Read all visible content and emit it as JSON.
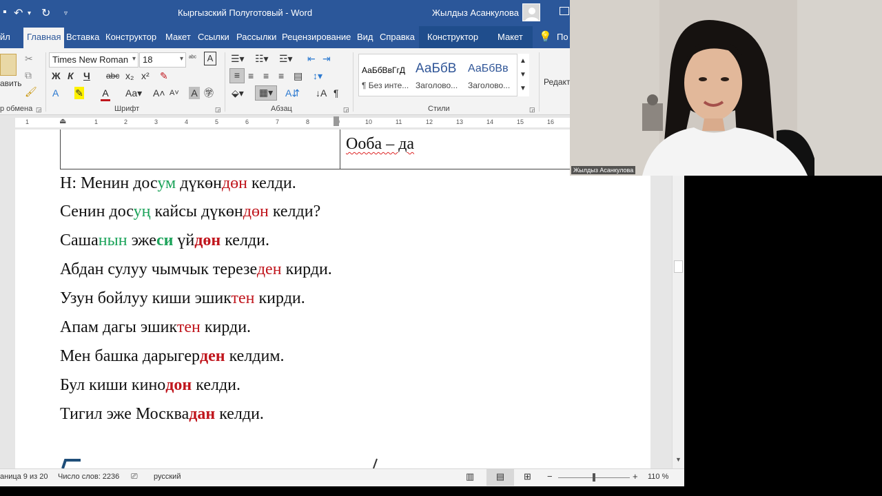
{
  "window": {
    "title": "Кыргызский Полуготовый  -  Word",
    "user_name": "Жылдыз Асанкулова",
    "accent": "#2b579a"
  },
  "tabs": {
    "file": "йл",
    "home": "Главная",
    "insert": "Вставка",
    "design": "Конструктор",
    "layout": "Макет",
    "references": "Ссылки",
    "mailings": "Рассылки",
    "review": "Рецензирование",
    "view": "Вид",
    "help": "Справка",
    "table_design": "Конструктор",
    "table_layout": "Макет",
    "tell_me": "По"
  },
  "ribbon": {
    "clipboard_paste": "авить",
    "clipboard_label": "р обмена",
    "font_name": "Times New Roman",
    "font_size": "18",
    "font_label": "Шрифт",
    "paragraph_label": "Абзац",
    "styles_label": "Стили",
    "editing_label": "Редакт",
    "bold": "Ж",
    "italic": "К",
    "underline": "Ч",
    "strike": "abc",
    "subscript": "x₂",
    "superscript": "x²",
    "styles": [
      {
        "preview": "АаБбВвГгД",
        "name": "¶ Без инте..."
      },
      {
        "preview": "АаБбВ",
        "name": "Заголово..."
      },
      {
        "preview": "АаБбВв",
        "name": "Заголово..."
      }
    ]
  },
  "ruler_numbers": [
    "1",
    "1",
    "2",
    "3",
    "4",
    "5",
    "6",
    "7",
    "8",
    "9",
    "10",
    "11",
    "12",
    "13",
    "14",
    "15",
    "16"
  ],
  "document": {
    "table_cell_right": "Ооба – да",
    "lines": [
      [
        {
          "t": "Н: Менин дос"
        },
        {
          "t": "ум",
          "c": "g"
        },
        {
          "t": " дүкөн"
        },
        {
          "t": "дөн",
          "c": "r"
        },
        {
          "t": " келди."
        }
      ],
      [
        {
          "t": "Сенин дос"
        },
        {
          "t": "уң",
          "c": "g"
        },
        {
          "t": " кайсы дүкөн"
        },
        {
          "t": "дөн",
          "c": "r"
        },
        {
          "t": " келди?"
        }
      ],
      [
        {
          "t": "Саша"
        },
        {
          "t": "нын",
          "c": "g"
        },
        {
          "t": " эже"
        },
        {
          "t": "си",
          "c": "g",
          "b": true
        },
        {
          "t": " үй"
        },
        {
          "t": "дөн",
          "c": "r",
          "b": true
        },
        {
          "t": " келди."
        }
      ],
      [
        {
          "t": "Абдан сулуу чымчык терезе"
        },
        {
          "t": "ден",
          "c": "r"
        },
        {
          "t": " кирди."
        }
      ],
      [
        {
          "t": "Узун бойлуу киши эшик"
        },
        {
          "t": "тен",
          "c": "r"
        },
        {
          "t": " кирди."
        }
      ],
      [
        {
          "t": "Апам дагы эшик"
        },
        {
          "t": "тен",
          "c": "r"
        },
        {
          "t": " кирди."
        }
      ],
      [
        {
          "t": "Мен башка дарыгер"
        },
        {
          "t": "ден",
          "c": "r",
          "b": true
        },
        {
          "t": " келдим."
        }
      ],
      [
        {
          "t": "Бул киши кино"
        },
        {
          "t": "дон",
          "c": "r",
          "b": true
        },
        {
          "t": " келди."
        }
      ],
      [
        {
          "t": "Тигил эже Москва"
        },
        {
          "t": "дан",
          "c": "r",
          "b": true
        },
        {
          "t": " келди."
        }
      ]
    ]
  },
  "status": {
    "page": "аница 9 из 20",
    "words": "Число слов: 2236",
    "language": "русский",
    "zoom_label": "110 %",
    "zoom_level": 0.5
  },
  "webcam": {
    "participant": "Жылдыз Асанкулова"
  }
}
